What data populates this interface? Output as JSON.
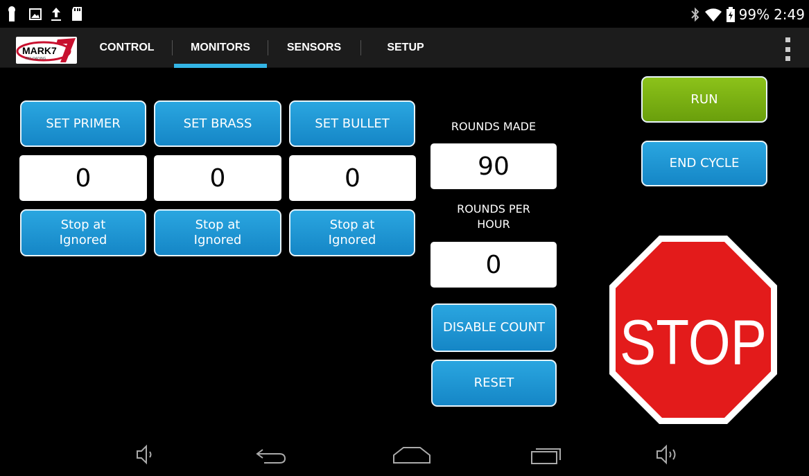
{
  "status_bar": {
    "battery": "99%",
    "time": "2:49",
    "icons": [
      "keyhole-icon",
      "image-icon",
      "upload-icon",
      "sd-card-icon",
      "bluetooth-icon",
      "wifi-icon",
      "battery-icon"
    ]
  },
  "app": {
    "logo_text": "MARK7",
    "logo_sub": "RELOADING",
    "tabs": [
      {
        "label": "CONTROL"
      },
      {
        "label": "MONITORS"
      },
      {
        "label": "SENSORS"
      },
      {
        "label": "SETUP"
      }
    ],
    "active_tab": "MONITORS",
    "accent_color": "#33b5e5"
  },
  "monitors": {
    "primer": {
      "button": "SET PRIMER",
      "value": "0",
      "stop_l1": "Stop at",
      "stop_l2": "Ignored"
    },
    "brass": {
      "button": "SET BRASS",
      "value": "0",
      "stop_l1": "Stop at",
      "stop_l2": "Ignored"
    },
    "bullet": {
      "button": "SET BULLET",
      "value": "0",
      "stop_l1": "Stop at",
      "stop_l2": "Ignored"
    }
  },
  "counts": {
    "rounds_made_label": "ROUNDS MADE",
    "rounds_made": "90",
    "rounds_per_hour_l1": "ROUNDS PER",
    "rounds_per_hour_l2": "HOUR",
    "rounds_per_hour": "0",
    "disable_count": "DISABLE COUNT",
    "reset": "RESET"
  },
  "controls": {
    "run": "RUN",
    "end_cycle": "END CYCLE",
    "stop": "STOP",
    "run_color": "#7cb518",
    "button_color": "#1e96d4",
    "stop_color": "#e31b1b"
  },
  "nav_bar": {
    "icons": [
      "volume-down-icon",
      "back-icon",
      "home-icon",
      "recent-apps-icon",
      "volume-up-icon"
    ]
  }
}
